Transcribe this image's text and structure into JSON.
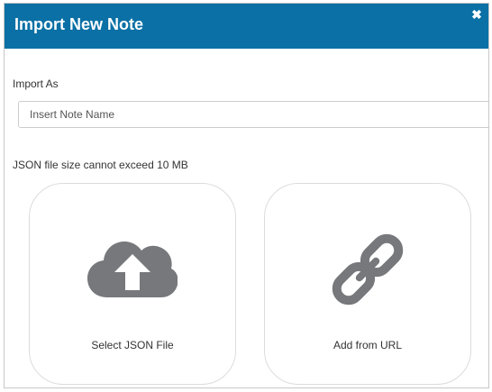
{
  "dialog": {
    "title": "Import New Note",
    "close_glyph": "✖"
  },
  "form": {
    "import_as_label": "Import As",
    "note_name_placeholder": "Insert Note Name",
    "size_note": "JSON file size cannot exceed 10 MB"
  },
  "options": [
    {
      "label": "Select JSON File",
      "icon": "cloud-upload-icon"
    },
    {
      "label": "Add from URL",
      "icon": "link-icon"
    }
  ],
  "colors": {
    "header": "#0a70a5",
    "icon": "#76787c"
  }
}
